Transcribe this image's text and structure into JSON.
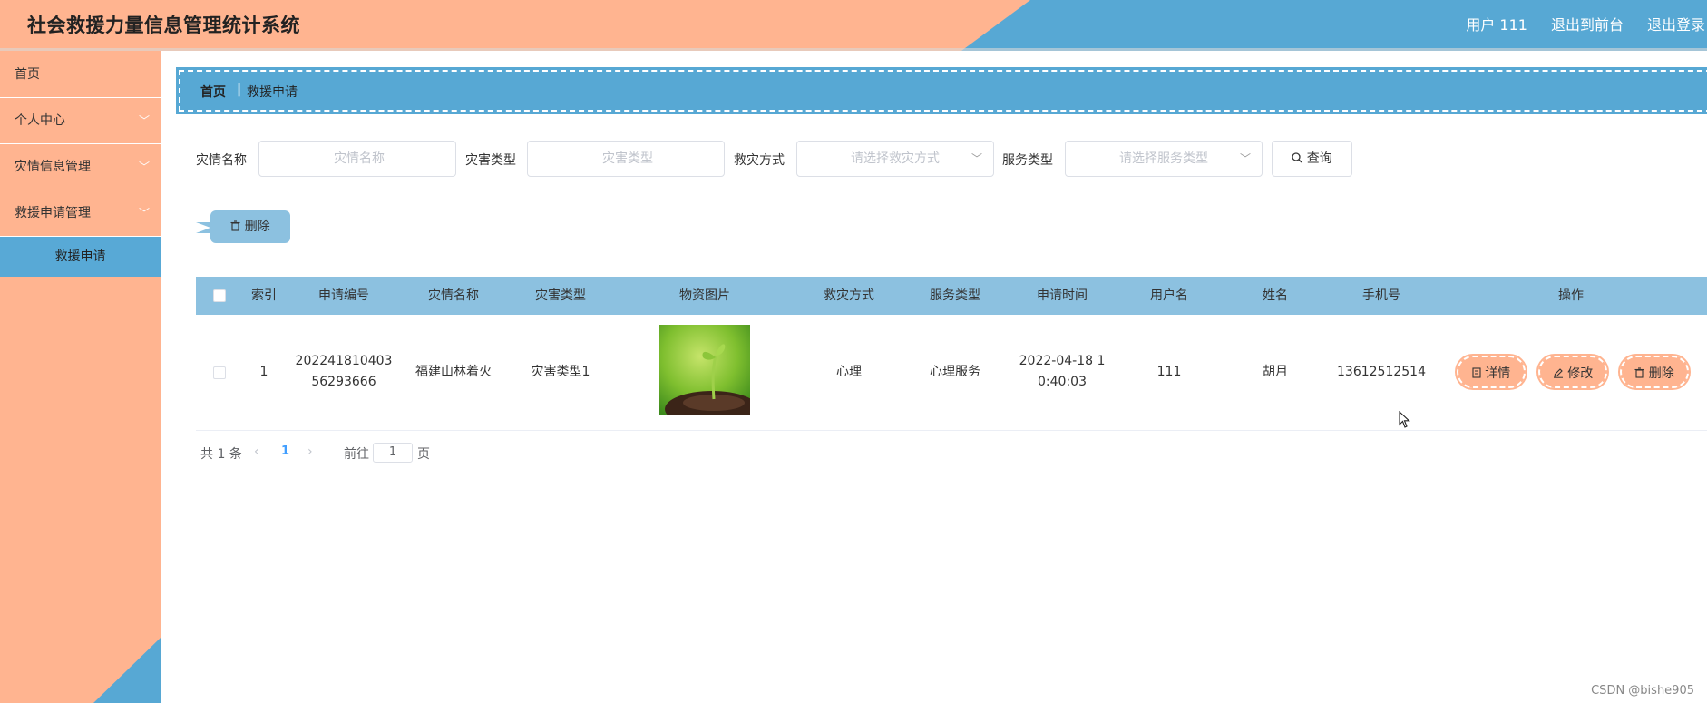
{
  "header": {
    "app_title": "社会救援力量信息管理统计系统",
    "user": "用户 111",
    "to_front": "退出到前台",
    "logout": "退出登录",
    "colors": {
      "left": "#ffb490",
      "right": "#57a8d4"
    }
  },
  "sidebar": {
    "items": [
      {
        "label": "首页"
      },
      {
        "label": "个人中心"
      },
      {
        "label": "灾情信息管理"
      },
      {
        "label": "救援申请管理"
      }
    ],
    "active_sub": "救援申请"
  },
  "breadcrumb": {
    "home": "首页",
    "separator": "|",
    "current": "救援申请"
  },
  "search": {
    "disaster_name": {
      "label": "灾情名称",
      "placeholder": "灾情名称"
    },
    "disaster_type": {
      "label": "灾害类型",
      "placeholder": "灾害类型"
    },
    "rescue_method": {
      "label": "救灾方式",
      "placeholder": "请选择救灾方式"
    },
    "service_type": {
      "label": "服务类型",
      "placeholder": "请选择服务类型"
    },
    "query_button": "查询"
  },
  "toolbar": {
    "delete_button": "删除"
  },
  "table": {
    "columns": [
      "索引",
      "申请编号",
      "灾情名称",
      "灾害类型",
      "物资图片",
      "救灾方式",
      "服务类型",
      "申请时间",
      "用户名",
      "姓名",
      "手机号",
      "操作"
    ],
    "rows": [
      {
        "index": "1",
        "app_no_line1": "202241810403",
        "app_no_line2": "56293666",
        "disaster_name": "福建山林着火",
        "disaster_type": "灾害类型1",
        "image": "seedling-photo",
        "rescue_method": "心理",
        "service_type": "心理服务",
        "time_line1": "2022-04-18 1",
        "time_line2": "0:40:03",
        "username": "111",
        "name": "胡月",
        "phone": "13612512514",
        "actions": {
          "detail": "详情",
          "edit": "修改",
          "delete": "删除"
        }
      }
    ]
  },
  "pagination": {
    "total": "共 1 条",
    "current_page": "1",
    "goto_label": "前往",
    "goto_value": "1",
    "page_suffix": "页"
  },
  "watermark": "CSDN @bishe905"
}
